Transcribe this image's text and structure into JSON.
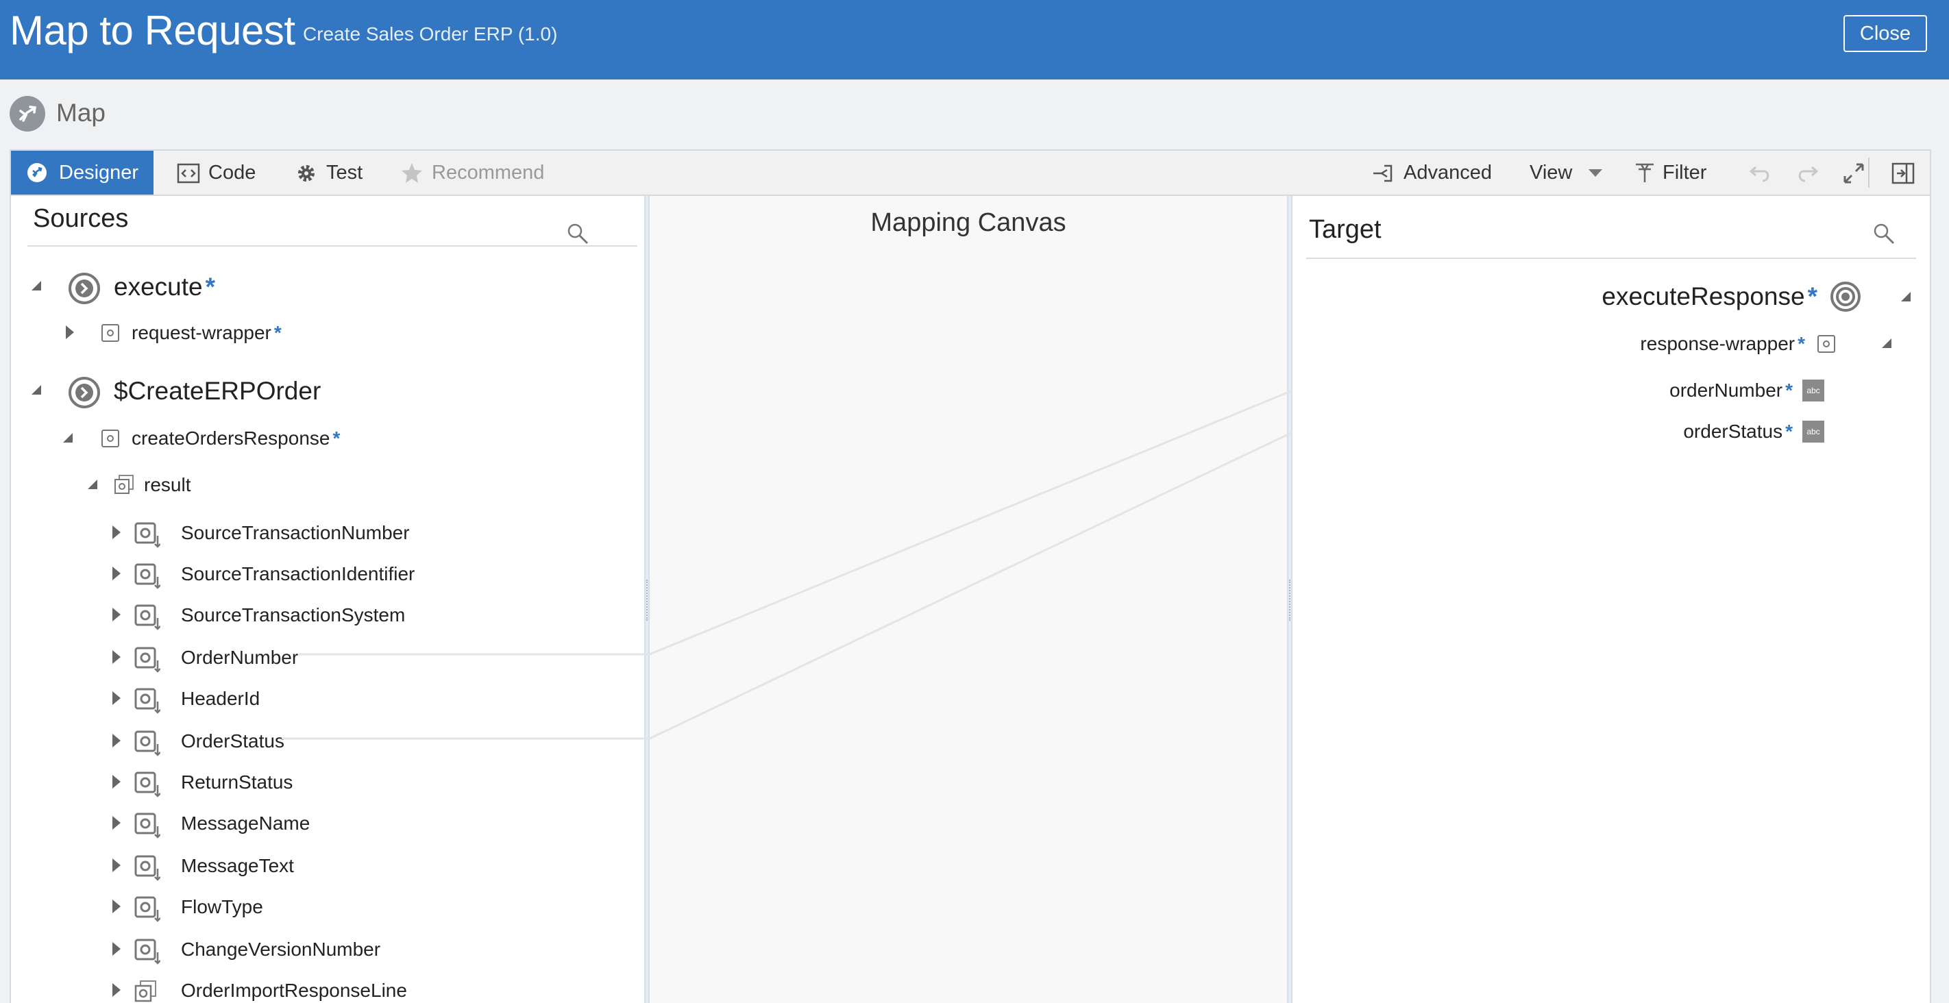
{
  "header": {
    "title": "Map to Request",
    "subtitle": "Create Sales Order ERP (1.0)",
    "close_label": "Close"
  },
  "section": {
    "label": "Map"
  },
  "toolbar": {
    "tabs": [
      {
        "label": "Designer",
        "icon": "designer-icon",
        "active": true
      },
      {
        "label": "Code",
        "icon": "code-icon"
      },
      {
        "label": "Test",
        "icon": "gear-icon"
      },
      {
        "label": "Recommend",
        "icon": "star-icon",
        "disabled": true
      }
    ],
    "advanced_label": "Advanced",
    "view_label": "View",
    "filter_label": "Filter"
  },
  "sources": {
    "title": "Sources",
    "tree": [
      {
        "label": "execute",
        "required": true,
        "level": 0
      },
      {
        "label": "request-wrapper",
        "required": true,
        "level": 1
      },
      {
        "label": "$CreateERPOrder",
        "required": false,
        "level": 0
      },
      {
        "label": "createOrdersResponse",
        "required": true,
        "level": 1
      },
      {
        "label": "result",
        "level": 2
      },
      {
        "label": "SourceTransactionNumber",
        "level": 3
      },
      {
        "label": "SourceTransactionIdentifier",
        "level": 3
      },
      {
        "label": "SourceTransactionSystem",
        "level": 3
      },
      {
        "label": "OrderNumber",
        "level": 3
      },
      {
        "label": "HeaderId",
        "level": 3
      },
      {
        "label": "OrderStatus",
        "level": 3
      },
      {
        "label": "ReturnStatus",
        "level": 3
      },
      {
        "label": "MessageName",
        "level": 3
      },
      {
        "label": "MessageText",
        "level": 3
      },
      {
        "label": "FlowType",
        "level": 3
      },
      {
        "label": "ChangeVersionNumber",
        "level": 3
      },
      {
        "label": "OrderImportResponseLine",
        "level": 3
      }
    ]
  },
  "canvas": {
    "title": "Mapping Canvas"
  },
  "target": {
    "title": "Target",
    "tree": [
      {
        "label": "executeResponse",
        "required": true
      },
      {
        "label": "response-wrapper",
        "required": true
      },
      {
        "label": "orderNumber",
        "required": true,
        "type_badge": "abc"
      },
      {
        "label": "orderStatus",
        "required": true,
        "type_badge": "abc"
      }
    ]
  },
  "colors": {
    "header_bg": "#3376c2",
    "required": "#3376c2"
  }
}
